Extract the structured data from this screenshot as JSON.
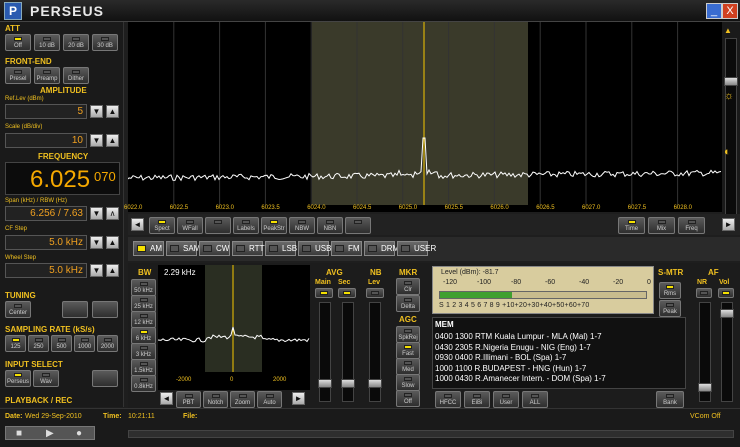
{
  "window": {
    "title": "PERSEUS",
    "icon": "P",
    "min": "_",
    "close": "X"
  },
  "att": {
    "title": "ATT",
    "buttons": [
      "Off",
      "10 dB",
      "20 dB",
      "30 dB"
    ],
    "active": 0
  },
  "frontend": {
    "title": "FRONT-END",
    "buttons": [
      "Presel",
      "Preamp",
      "Dither"
    ]
  },
  "amplitude": {
    "title": "AMPLITUDE",
    "reflev_label": "Ref.Lev (dBm)",
    "reflev": "5",
    "scale_label": "Scale (dB/div)",
    "scale": "10"
  },
  "frequency": {
    "title": "FREQUENCY",
    "main": "6.025",
    "sub": "070",
    "span_label": "Span (kHz) / RBW (Hz)",
    "span": "6.256 / 7.63",
    "cfstep_label": "CF Step",
    "cfstep": "5.0 kHz",
    "wheel_label": "Wheel Step",
    "wheel": "5.0 kHz"
  },
  "tuning": {
    "title": "TUNING",
    "center": "Center"
  },
  "sampling": {
    "title": "SAMPLING RATE (kS/s)",
    "buttons": [
      "125",
      "250",
      "500",
      "1000",
      "2000"
    ]
  },
  "input": {
    "title": "INPUT SELECT",
    "buttons": [
      "Perseus",
      "Wav"
    ]
  },
  "playback": {
    "title": "PLAYBACK / REC"
  },
  "spectrum": {
    "ticks": [
      "6022.0",
      "6022.5",
      "6023.0",
      "6023.5",
      "6024.0",
      "6024.5",
      "6025.0",
      "6025.5",
      "6026.0",
      "6026.5",
      "6027.0",
      "6027.5",
      "6028.0"
    ],
    "toolbar": [
      "Spect",
      "WFall",
      "",
      "Labels",
      "PeakStr",
      "NBW",
      "NBN",
      ""
    ],
    "right_toolbar": [
      "Time",
      "Mix",
      "Freq"
    ]
  },
  "modes": [
    "AM",
    "SAM",
    "CW",
    "RTTY",
    "LSB",
    "USB",
    "FM",
    "DRM",
    "USER"
  ],
  "active_mode": "AM",
  "bw": {
    "title": "BW",
    "buttons": [
      "50 kHz",
      "25 kHz",
      "12 kHz",
      "6 kHz",
      "3 kHz",
      "1.5kHz",
      "0.8kHz"
    ],
    "display": "2.29 kHz",
    "ticks": [
      "-2000",
      "0",
      "2000"
    ],
    "bottom": [
      "PBT",
      "Notch",
      "Zoom",
      "Auto"
    ]
  },
  "avg": {
    "title": "AVG",
    "main": "Main",
    "sec": "Sec"
  },
  "nb": {
    "title": "NB",
    "lev": "Lev"
  },
  "mkr": {
    "title": "MKR",
    "buttons": [
      "Clr",
      "Delta"
    ]
  },
  "agc": {
    "title": "AGC",
    "buttons": [
      "SpkRej",
      "Fast",
      "Med",
      "Slow",
      "Off"
    ]
  },
  "level": {
    "text": "Level (dBm): -81.7",
    "top_scale": [
      "-120",
      "-100",
      "-80",
      "-60",
      "-40",
      "-20",
      "0"
    ],
    "bottom_scale": "S 1 2 3 4 5 6 7 8 9 +10+20+30+40+50+60+70",
    "fill": 0.35
  },
  "smtr": {
    "title": "S-MTR",
    "buttons": [
      "Rms",
      "Peak"
    ]
  },
  "af": {
    "title": "AF",
    "nr": "NR",
    "vol": "Vol"
  },
  "memory": {
    "title": "MEM",
    "lines": [
      "0400 1300 RTM Kuala Lumpur  - MLA (Mal)  1-7",
      "0430 2305 R.Nigeria Enugu  - NIG (Eng)  1-7",
      "0930 0400 R.Illimani  - BOL (Spa)  1-7",
      "1000 1100 R.BUDAPEST  - HNG (Hun)  1-7",
      "1000 0430 R.Amanecer Intern.  - DOM (Spa)  1-7"
    ],
    "buttons": [
      "HFCC",
      "EiBi",
      "User",
      "ALL"
    ],
    "bank": "Bank"
  },
  "status": {
    "date_label": "Date:",
    "date": "Wed 29-Sep-2010",
    "time_label": "Time:",
    "time": "10:21:11",
    "file_label": "File:",
    "vcom": "VCom Off"
  }
}
